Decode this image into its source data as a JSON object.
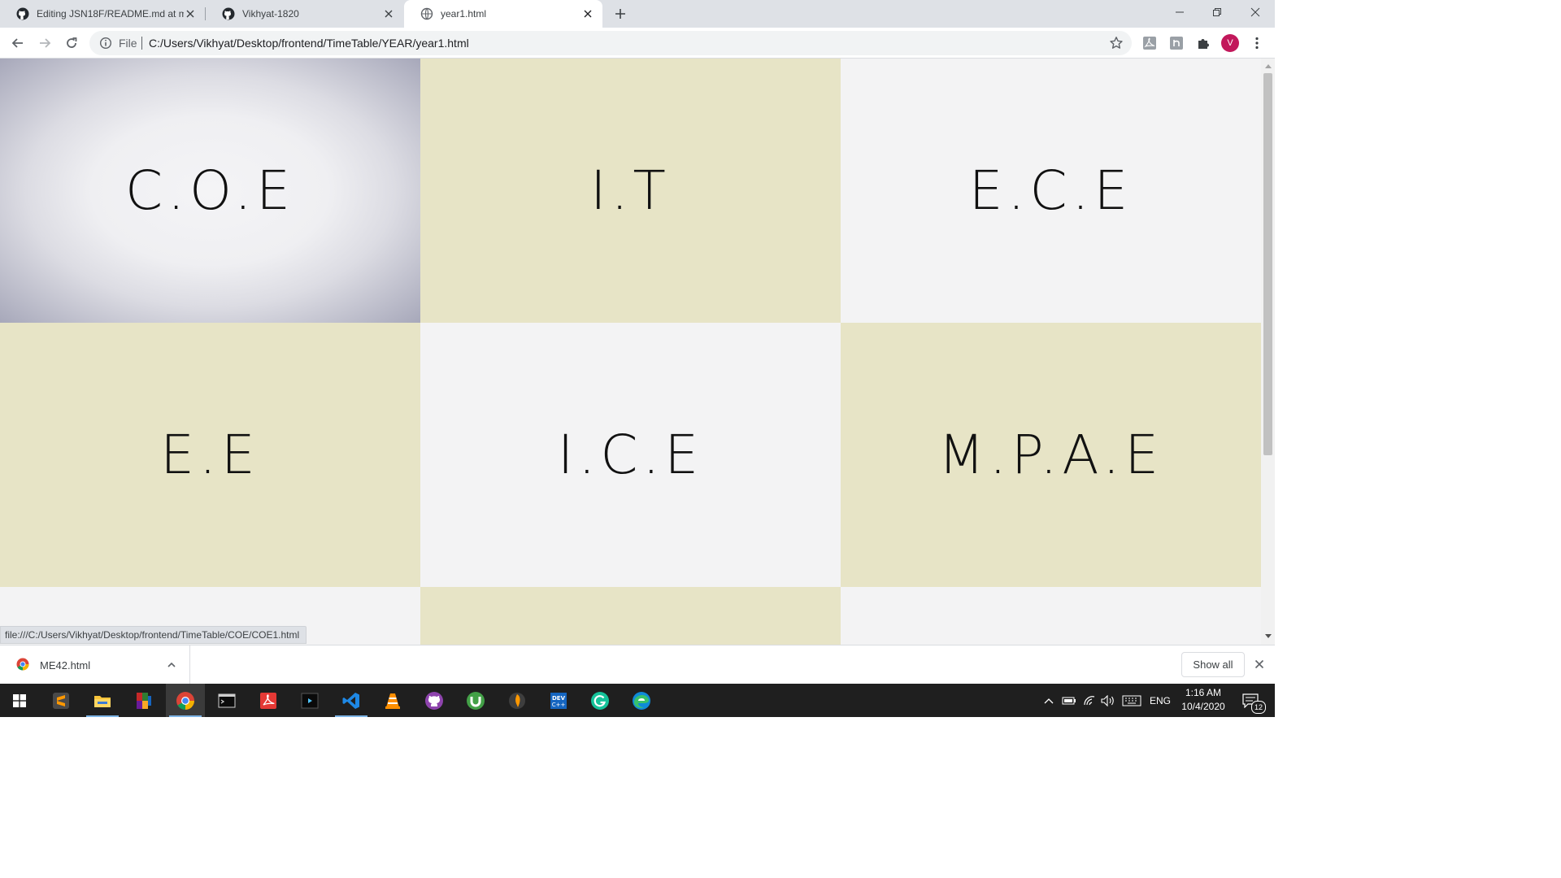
{
  "browser": {
    "tabs": [
      {
        "title": "Editing JSN18F/README.md at m",
        "favicon": "github-icon",
        "active": false
      },
      {
        "title": "Vikhyat-1820",
        "favicon": "github-icon",
        "active": false
      },
      {
        "title": "year1.html",
        "favicon": "globe-icon",
        "active": true
      }
    ],
    "address_bar": {
      "scheme_label": "File",
      "url": "C:/Users/Vikhyat/Desktop/frontend/TimeTable/YEAR/year1.html"
    },
    "profile_initial": "V",
    "status_url": "file:///C:/Users/Vikhyat/Desktop/frontend/TimeTable/COE/COE1.html"
  },
  "page": {
    "tiles": [
      {
        "label": "C.O.E",
        "style": "hovered"
      },
      {
        "label": "I.T",
        "style": "beige"
      },
      {
        "label": "E.C.E",
        "style": "light"
      },
      {
        "label": "E.E",
        "style": "beige"
      },
      {
        "label": "I.C.E",
        "style": "light"
      },
      {
        "label": "M.P.A.E",
        "style": "beige"
      },
      {
        "label": "",
        "style": "light"
      },
      {
        "label": "",
        "style": "beige"
      },
      {
        "label": "",
        "style": "light"
      }
    ],
    "colors": {
      "beige": "#e7e4c6",
      "light": "#f3f3f4"
    }
  },
  "downloads": {
    "items": [
      {
        "name": "ME42.html"
      }
    ],
    "show_all_label": "Show all"
  },
  "taskbar": {
    "apps": [
      "start-icon",
      "sublime-text-icon",
      "file-explorer-icon",
      "winrar-icon",
      "chrome-icon",
      "terminal-icon",
      "acrobat-icon",
      "media-player-icon",
      "vscode-icon",
      "vlc-icon",
      "github-desktop-icon",
      "utorrent-icon",
      "fl-studio-icon",
      "devcpp-icon",
      "grammarly-icon",
      "edge-icon"
    ],
    "language": "ENG",
    "time": "1:16 AM",
    "date": "10/4/2020",
    "notification_count": "12"
  }
}
